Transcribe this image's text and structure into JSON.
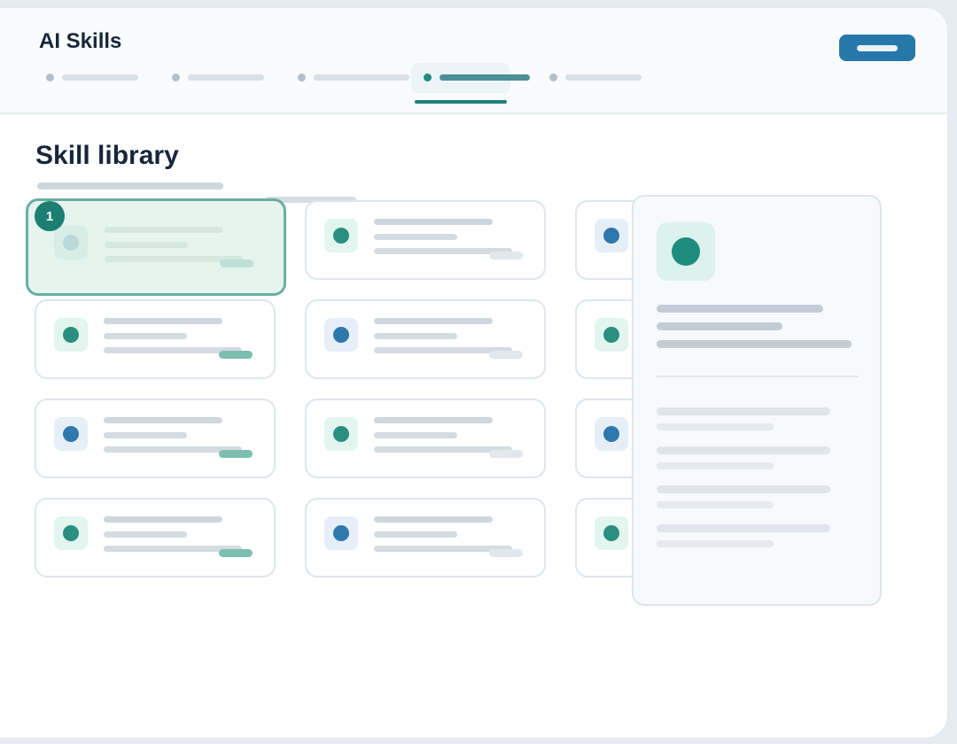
{
  "app": {
    "title": "AI Skills"
  },
  "header": {
    "action_button": {
      "icon": "placeholder-bar"
    },
    "tabs": [
      {
        "name": "tab-1",
        "active": false
      },
      {
        "name": "tab-2",
        "active": false
      },
      {
        "name": "tab-3",
        "active": false
      },
      {
        "name": "tab-4",
        "active": true
      },
      {
        "name": "tab-5",
        "active": false
      }
    ]
  },
  "main": {
    "title": "Skill library",
    "selected_step": "1"
  },
  "cards": [
    {
      "row": 1,
      "col": 1,
      "icon_color": "teal",
      "tag": "green",
      "selected": true
    },
    {
      "row": 1,
      "col": 2,
      "icon_color": "teal",
      "tag": "gray"
    },
    {
      "row": 1,
      "col": 3,
      "icon_color": "blue",
      "tag": "gray"
    },
    {
      "row": 2,
      "col": 1,
      "icon_color": "teal",
      "tag": "green"
    },
    {
      "row": 2,
      "col": 2,
      "icon_color": "blue",
      "tag": "gray"
    },
    {
      "row": 2,
      "col": 3,
      "icon_color": "teal",
      "tag": "gray"
    },
    {
      "row": 3,
      "col": 1,
      "icon_color": "blue",
      "tag": "green"
    },
    {
      "row": 3,
      "col": 2,
      "icon_color": "teal",
      "tag": "gray"
    },
    {
      "row": 3,
      "col": 3,
      "icon_color": "blue",
      "tag": "gray"
    },
    {
      "row": 4,
      "col": 1,
      "icon_color": "teal",
      "tag": "green"
    },
    {
      "row": 4,
      "col": 2,
      "icon_color": "blue",
      "tag": "gray"
    },
    {
      "row": 4,
      "col": 3,
      "icon_color": "teal",
      "tag": "gray"
    }
  ],
  "colors": {
    "accent": "#1f8c7e",
    "primary_button": "#2578a9",
    "teal_icon": "#2b8f80",
    "blue_icon": "#2f78ad",
    "selected_border": "#6aaea4",
    "heading": "#17263a"
  }
}
